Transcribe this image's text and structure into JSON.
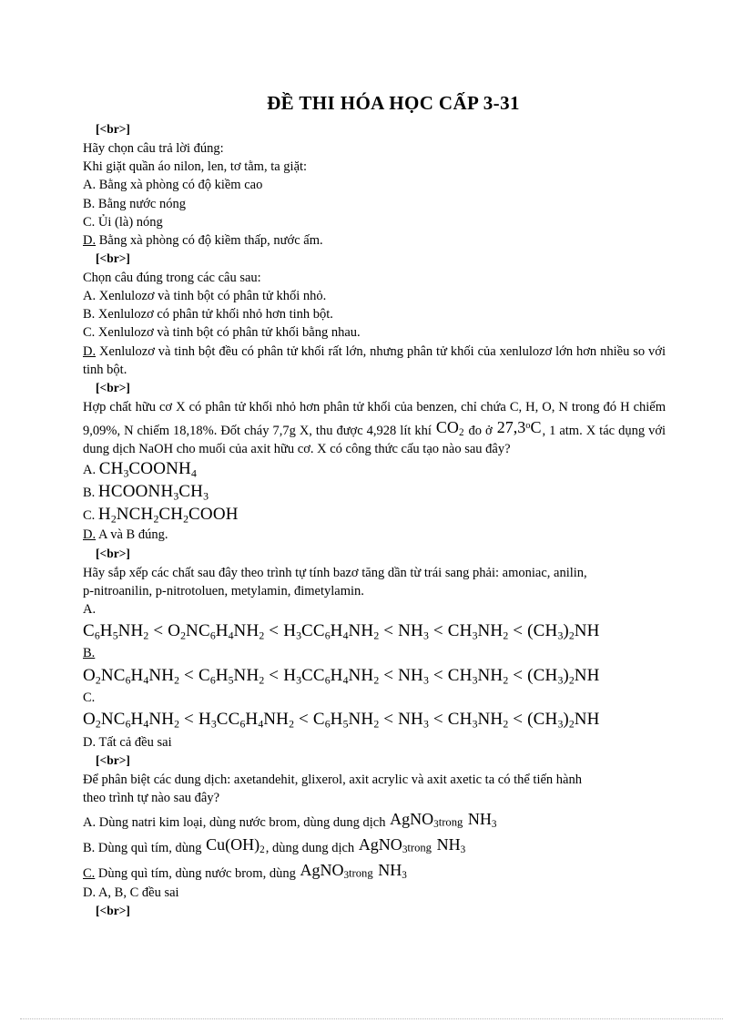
{
  "document": {
    "title": "ĐỀ THI HÓA HỌC CẤP 3-31",
    "br_marker": "[<br>]"
  },
  "questions": [
    {
      "id": "q1",
      "prompt_lines": [
        "Hãy chọn câu trả lời đúng:",
        "Khi giặt quần áo nilon, len, tơ tằm, ta giặt:"
      ],
      "options": [
        {
          "marker": "A.",
          "correct": false,
          "text": "Bằng xà phòng có độ kiềm cao"
        },
        {
          "marker": "B.",
          "correct": false,
          "text": "Bằng nước nóng"
        },
        {
          "marker": "C.",
          "correct": false,
          "text": "Ủi (là) nóng"
        },
        {
          "marker": "D.",
          "correct": true,
          "text": "Bằng xà phòng có độ kiềm thấp, nước ấm."
        }
      ]
    },
    {
      "id": "q2",
      "prompt_lines": [
        "Chọn câu đúng trong các câu sau:"
      ],
      "options": [
        {
          "marker": "A.",
          "correct": false,
          "text": "Xenlulozơ  và tinh bột có phân tử khối nhỏ."
        },
        {
          "marker": "B.",
          "correct": false,
          "text": "Xenlulozơ  có phân tử khối nhỏ hơn tinh bột."
        },
        {
          "marker": "C.",
          "correct": false,
          "text": "Xenlulozơ  và tinh bột có phân tử khối bằng nhau."
        },
        {
          "marker": "D.",
          "correct": true,
          "text": "Xenlulozơ  và tinh bột đều có phân tử khối rất lớn, nhưng phân tử khối của xenlulozơ  lớn hơn nhiều  so với tinh bột."
        }
      ]
    },
    {
      "id": "q3",
      "prompt_part1": "Hợp chất hữu cơ X có phân tử khối nhỏ hơn phân tử khối của benzen, chỉ chứa C, H, O, N trong đó H chiếm  9,09%, N chiếm  18,18%. Đốt cháy 7,7g X, thu được 4,928 lít khí",
      "formula_co2": {
        "base": "CO",
        "sub": "2"
      },
      "prompt_part2": "đo ở",
      "formula_temp": {
        "value": "27,3",
        "deg": "o",
        "unit": "C"
      },
      "prompt_part3": ", 1 atm. X tác dụng với  dung dịch NaOH cho muối của axit hữu cơ. X có công thức cấu tạo nào sau đây?",
      "options": [
        {
          "marker": "A.",
          "correct": false,
          "formula": "CH3COONH4"
        },
        {
          "marker": "B.",
          "correct": false,
          "formula": "HCOONH3CH3"
        },
        {
          "marker": "C.",
          "correct": false,
          "formula": "H2NCH2CH2COOH"
        },
        {
          "marker": "D.",
          "correct": true,
          "text": "A và B đúng."
        }
      ]
    },
    {
      "id": "q4",
      "prompt_lines": [
        "Hãy sắp xếp các chất sau đây theo trình tự tính bazơ tăng dần từ trái sang phải: amoniac,  anilin,",
        "p-nitroanilin,  p-nitrotoluen,  metylamin,  đimetylamin."
      ],
      "options": [
        {
          "marker": "A.",
          "correct": false,
          "sequence": [
            "C6H5NH2",
            "O2NC6H4NH2",
            "H3CC6H4NH2",
            "NH3",
            "CH3NH2",
            "(CH3)2NH"
          ]
        },
        {
          "marker": "B.",
          "correct": true,
          "sequence": [
            "O2NC6H4NH2",
            "C6H5NH2",
            "H3CC6H4NH2",
            "NH3",
            "CH3NH2",
            "(CH3)2NH"
          ]
        },
        {
          "marker": "C.",
          "correct": false,
          "sequence": [
            "O2NC6H4NH2",
            "H3CC6H4NH2",
            "C6H5NH2",
            "NH3",
            "CH3NH2",
            "(CH3)2NH"
          ]
        },
        {
          "marker": "D.",
          "correct": false,
          "text": "Tất cả đều sai"
        }
      ],
      "operator": "<"
    },
    {
      "id": "q5",
      "prompt_lines": [
        "Để phân biệt các dung dịch: axetandehit,  glixerol,  axit acrylic và axit axetic ta có thể tiến hành",
        "theo trình tự nào sau đây?"
      ],
      "options": [
        {
          "marker": "A.",
          "correct": false,
          "pre": "Dùng natri kim loại, dùng nước brom, dùng dung dịch",
          "f1": "AgNO3",
          "mid": "trong",
          "f2": "NH3"
        },
        {
          "marker": "B.",
          "correct": false,
          "pre": "Dùng quì tím,  dùng",
          "f0": "Cu(OH)2",
          "mid0": ", dùng dung dịch",
          "f1": "AgNO3",
          "mid": "trong",
          "f2": "NH3"
        },
        {
          "marker": "C.",
          "correct": true,
          "pre": "Dùng quì tím,  dùng nước brom, dùng",
          "f1": "AgNO3",
          "mid": "trong",
          "f2": "NH3"
        },
        {
          "marker": "D.",
          "correct": false,
          "text": "A, B, C đều sai"
        }
      ]
    }
  ]
}
